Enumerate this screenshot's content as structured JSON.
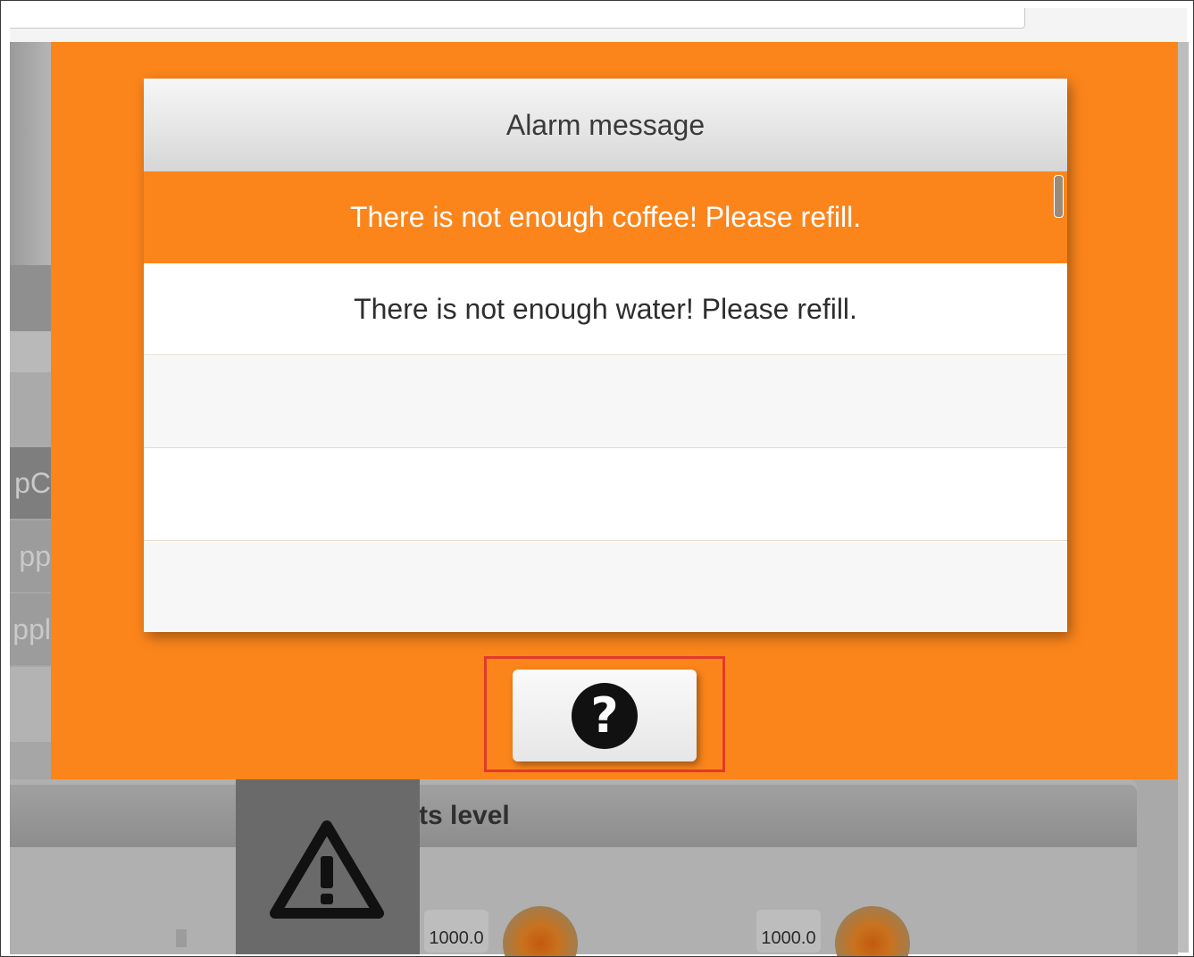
{
  "overlay": {
    "background_color": "#fb851b"
  },
  "background_app": {
    "left_tabs": [
      "pC",
      "pp",
      "ppl"
    ],
    "panel_title_partial": "ts level",
    "values": [
      "1000.0",
      "1000.0"
    ],
    "warning_icon": "warning-triangle-icon"
  },
  "alarm_dialog": {
    "title": "Alarm message",
    "alarms": [
      {
        "text": "There is not enough coffee! Please refill.",
        "selected": true
      },
      {
        "text": "There is not enough water! Please refill.",
        "selected": false
      },
      {
        "text": "",
        "selected": false
      },
      {
        "text": "",
        "selected": false
      },
      {
        "text": "",
        "selected": false
      }
    ],
    "scroll_position_fraction": 0.0
  },
  "help_button": {
    "icon": "question-circle-icon",
    "symbol": "?",
    "highlighted": true,
    "highlight_color": "#e23a2a"
  }
}
